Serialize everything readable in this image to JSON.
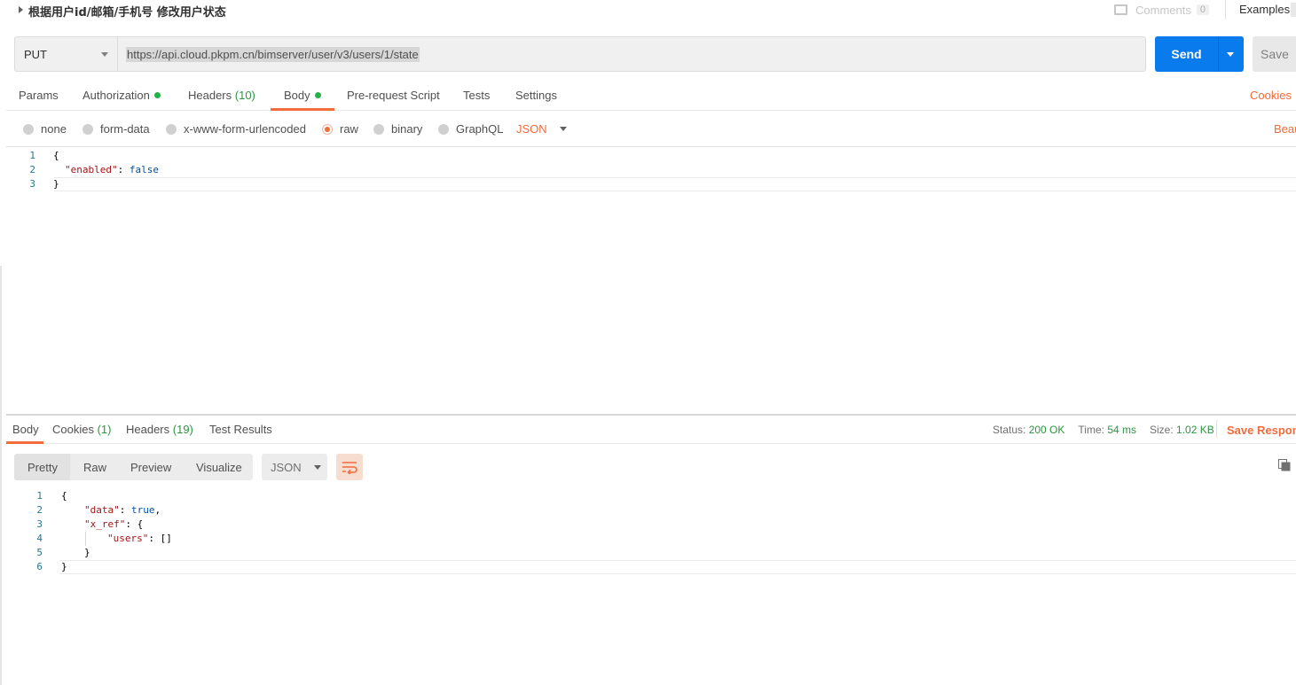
{
  "request": {
    "title": "根据用户id/邮箱/手机号 修改用户状态",
    "comments_label": "Comments",
    "comments_count": "0",
    "examples_label": "Examples",
    "method": "PUT",
    "url": "https://api.cloud.pkpm.cn/bimserver/user/v3/users/1/state",
    "send_label": "Send",
    "save_label": "Save"
  },
  "request_tabs": {
    "params": "Params",
    "authorization": "Authorization",
    "headers": "Headers",
    "headers_count": "(10)",
    "body": "Body",
    "prerequest": "Pre-request Script",
    "tests": "Tests",
    "settings": "Settings",
    "cookies": "Cookies"
  },
  "body_options": {
    "none": "none",
    "form_data": "form-data",
    "urlencoded": "x-www-form-urlencoded",
    "raw": "raw",
    "binary": "binary",
    "graphql": "GraphQL",
    "format": "JSON",
    "beautify": "Beau"
  },
  "request_body": {
    "line_numbers": [
      "1",
      "2",
      "3"
    ],
    "open": "{",
    "key": "\"enabled\"",
    "colon": ": ",
    "value": "false",
    "close": "}"
  },
  "response_tabs": {
    "body": "Body",
    "cookies": "Cookies",
    "cookies_count": "(1)",
    "headers": "Headers",
    "headers_count": "(19)",
    "test_results": "Test Results"
  },
  "response_meta": {
    "status_label": "Status:",
    "status_value": "200 OK",
    "time_label": "Time:",
    "time_value": "54 ms",
    "size_label": "Size:",
    "size_value": "1.02 KB",
    "save_response": "Save Respons"
  },
  "response_view": {
    "pretty": "Pretty",
    "raw": "Raw",
    "preview": "Preview",
    "visualize": "Visualize",
    "format": "JSON"
  },
  "response_body": {
    "line_numbers": [
      "1",
      "2",
      "3",
      "4",
      "5",
      "6"
    ],
    "open": "{",
    "data_key": "\"data\"",
    "data_value": "true",
    "xref_key": "\"x_ref\"",
    "users_key": "\"users\"",
    "users_value": "[]",
    "inner_close": "}",
    "close": "}"
  }
}
